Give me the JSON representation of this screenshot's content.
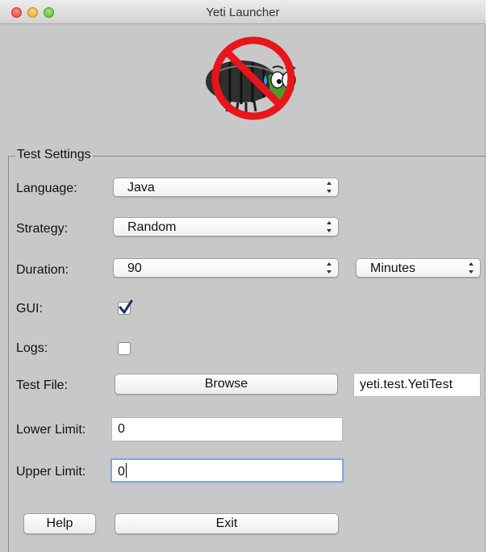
{
  "window": {
    "title": "Yeti Launcher"
  },
  "colors": {
    "no_sign_red": "#e8151b",
    "bug_green": "#4c9a2a",
    "focus_blue": "#7ba7e3"
  },
  "logo": {
    "icon": "no-bug-icon"
  },
  "settings": {
    "group_title": "Test Settings",
    "language": {
      "label": "Language:",
      "value": "Java"
    },
    "strategy": {
      "label": "Strategy:",
      "value": "Random"
    },
    "duration": {
      "label": "Duration:",
      "value": "90",
      "unit": "Minutes"
    },
    "gui": {
      "label": "GUI:",
      "checked": true
    },
    "logs": {
      "label": "Logs:",
      "checked": false
    },
    "test_file": {
      "label": "Test File:",
      "button": "Browse",
      "value": "yeti.test.YetiTest"
    },
    "lower_limit": {
      "label": "Lower Limit:",
      "value": "0"
    },
    "upper_limit": {
      "label": "Upper Limit:",
      "value": "0"
    }
  },
  "buttons": {
    "help": "Help",
    "exit": "Exit"
  }
}
